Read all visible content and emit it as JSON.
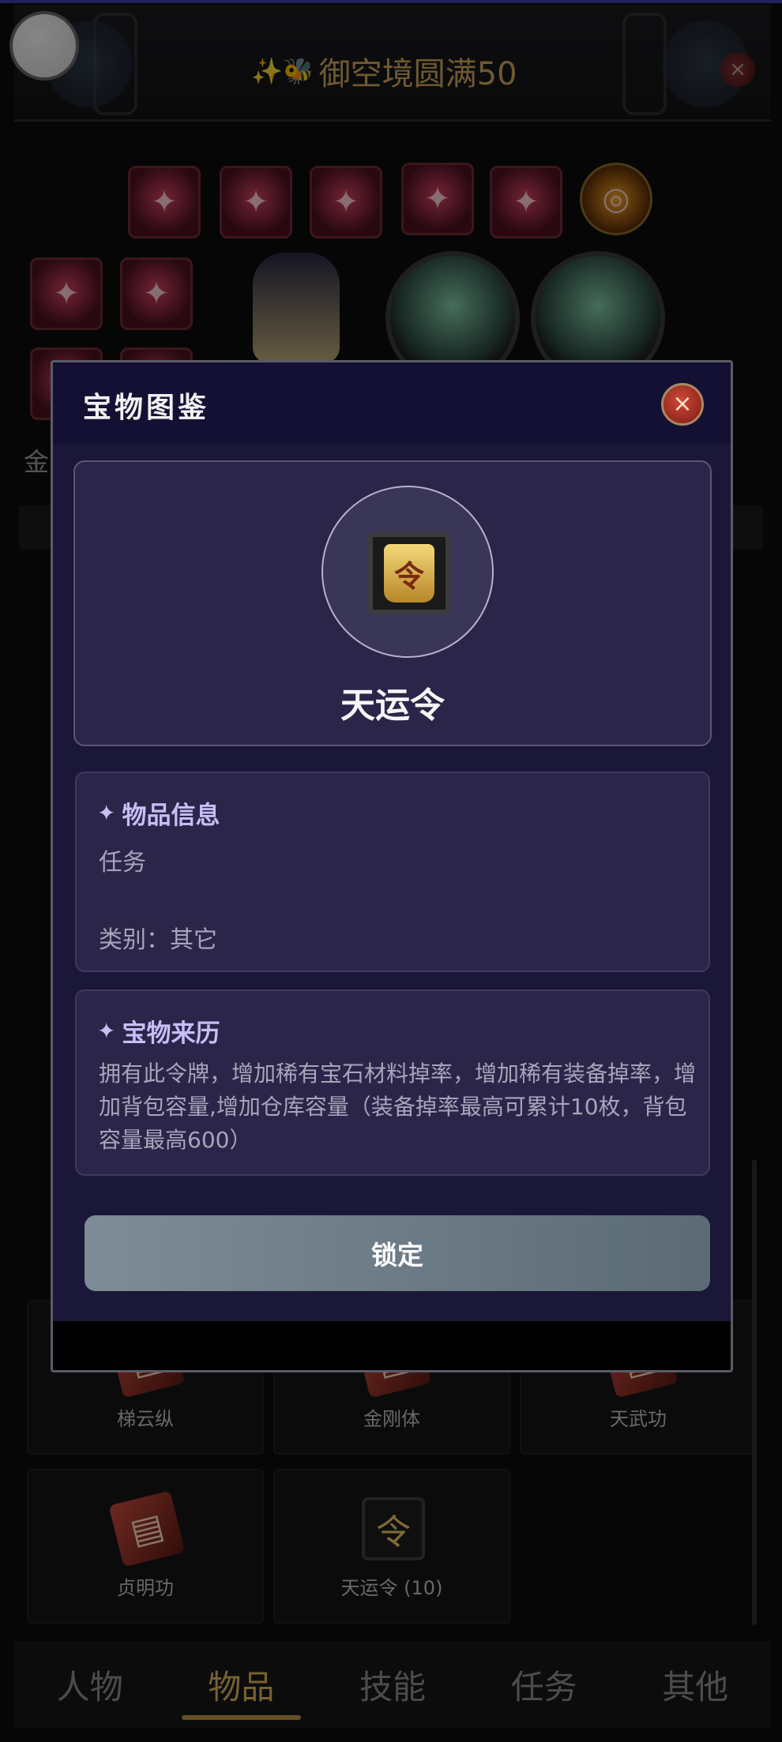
{
  "header": {
    "title": "御空境圆满50",
    "title_deco": "✨🐝"
  },
  "background_grid": {
    "row_label": "金",
    "cells": [
      {
        "label": "梯云纵",
        "icon": "book-icon"
      },
      {
        "label": "金刚体",
        "icon": "book-icon"
      },
      {
        "label": "天武功",
        "icon": "book-icon"
      },
      {
        "label": "贞明功",
        "icon": "book-icon"
      },
      {
        "label": "天运令 (10)",
        "icon": "token-icon"
      }
    ]
  },
  "tabs": [
    {
      "label": "人物",
      "active": false
    },
    {
      "label": "物品",
      "active": true
    },
    {
      "label": "技能",
      "active": false
    },
    {
      "label": "任务",
      "active": false
    },
    {
      "label": "其他",
      "active": false
    }
  ],
  "modal": {
    "title": "宝物图鉴",
    "close_icon": "×",
    "item_name": "天运令",
    "item_glyph": "令",
    "info": {
      "heading": "物品信息",
      "type": "任务",
      "category": "类别：其它"
    },
    "history": {
      "heading": "宝物来历",
      "text": "拥有此令牌，增加稀有宝石材料掉率，增加稀有装备掉率，增加背包容量,增加仓库容量（装备掉率最高可累计10枚，背包容量最高600）"
    },
    "lock_button": "锁定"
  },
  "colors": {
    "accent_gold": "#d9b15a",
    "modal_bg": "#1a1738",
    "card_bg": "#2b2649",
    "heading_purple": "#c8bdf5"
  }
}
